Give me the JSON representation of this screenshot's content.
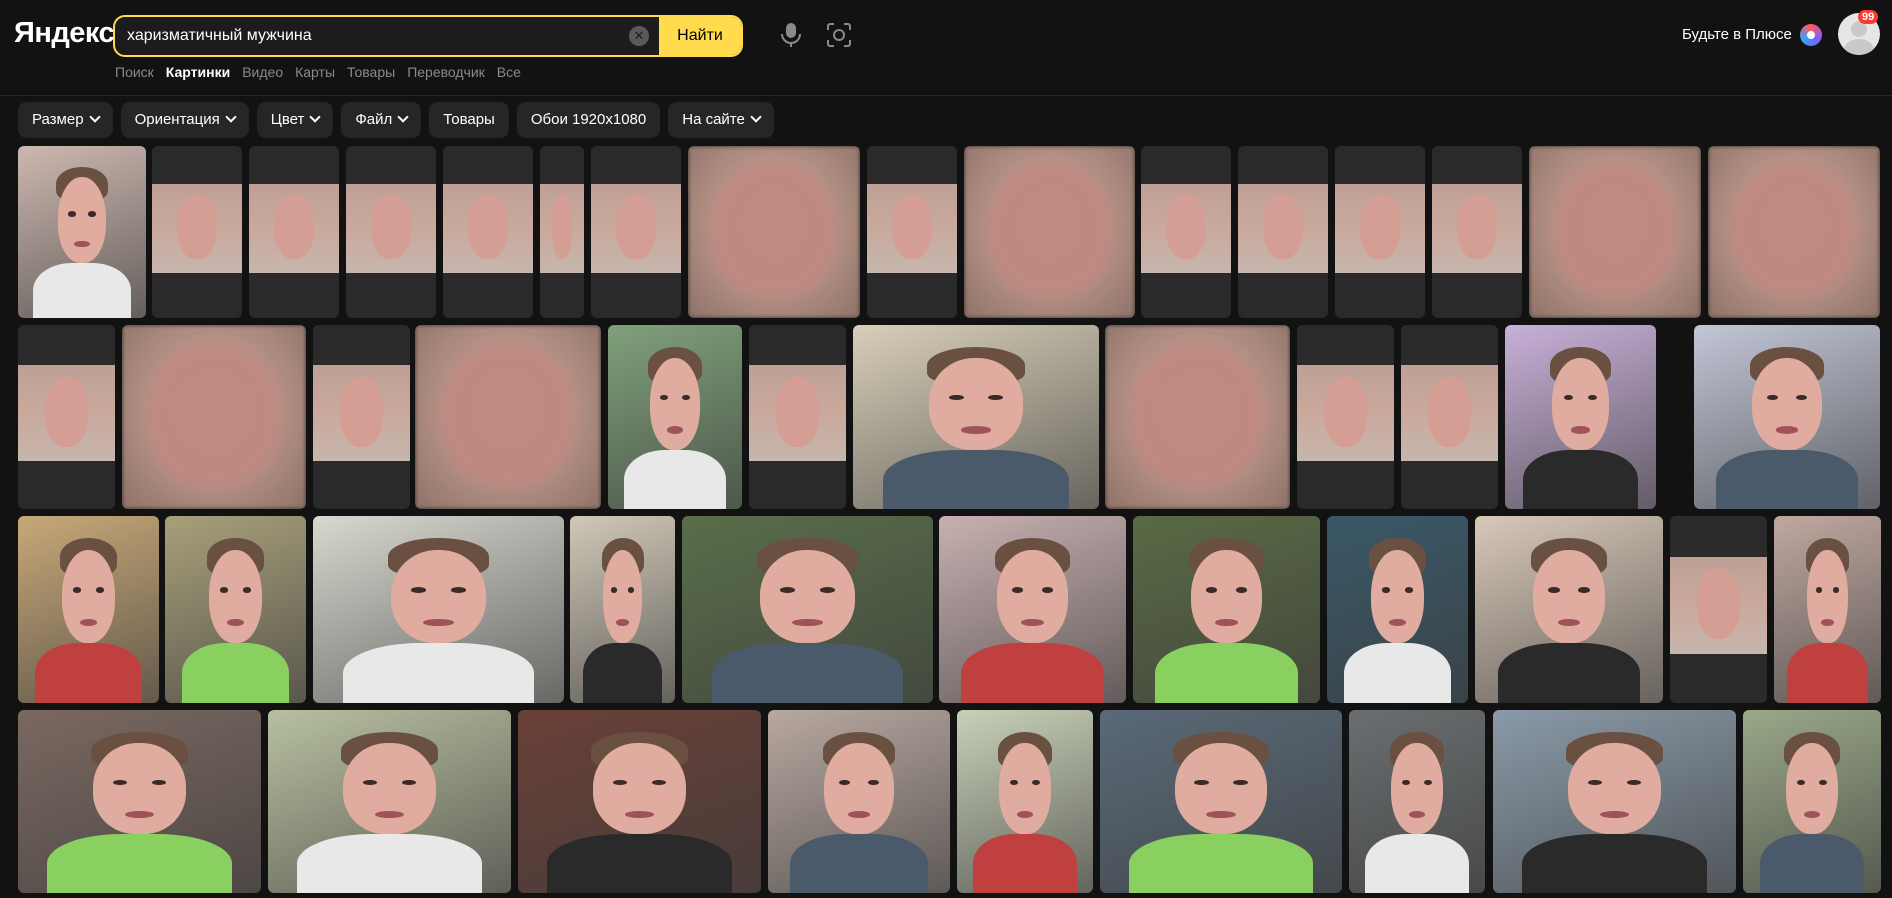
{
  "header": {
    "logo": "Яндекс",
    "search_value": "харизматичный мужчина",
    "find_label": "Найти",
    "plus_label": "Будьте в Плюсе",
    "notifications_count": "99"
  },
  "nav": {
    "items": [
      "Поиск",
      "Картинки",
      "Видео",
      "Карты",
      "Товары",
      "Переводчик",
      "Все"
    ],
    "active_index": 1
  },
  "filters": [
    {
      "label": "Размер",
      "dropdown": true
    },
    {
      "label": "Ориентация",
      "dropdown": true
    },
    {
      "label": "Цвет",
      "dropdown": true
    },
    {
      "label": "Файл",
      "dropdown": true
    },
    {
      "label": "Товары",
      "dropdown": false
    },
    {
      "label": "Обои 1920x1080",
      "dropdown": false
    },
    {
      "label": "На сайте",
      "dropdown": true
    }
  ],
  "colors": {
    "background": "#121212",
    "accent": "#ffdb4d",
    "chip": "#262626"
  },
  "icons": [
    "clear-icon",
    "microphone-icon",
    "camera-search-icon",
    "plus-icon",
    "avatar-icon",
    "chevron-down-icon"
  ]
}
